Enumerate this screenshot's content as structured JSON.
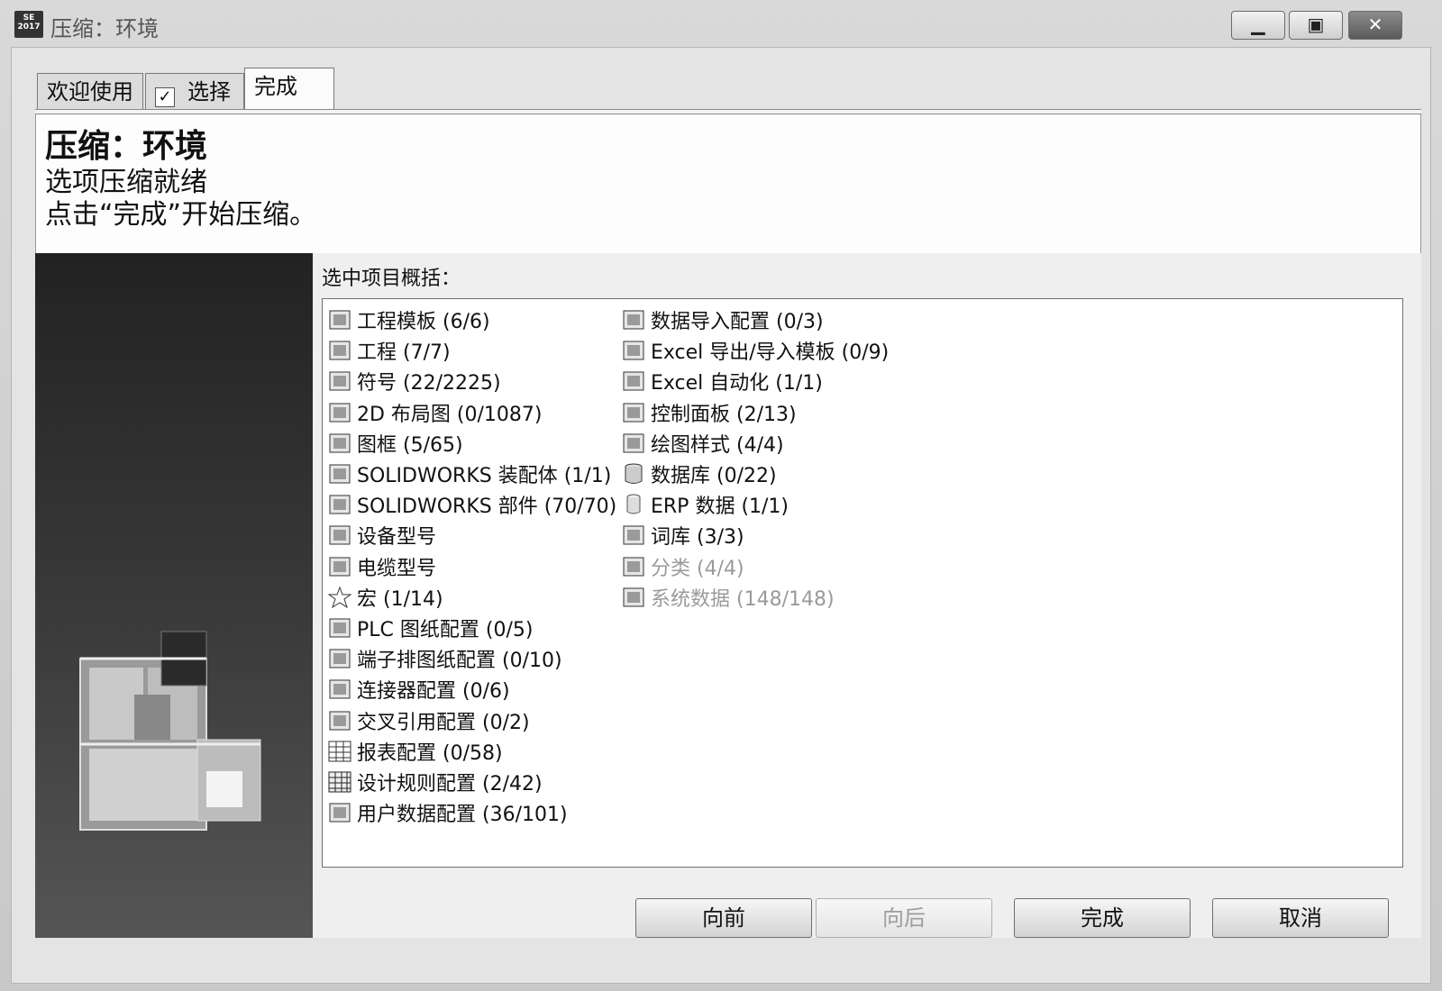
{
  "window": {
    "title": "压缩：环境",
    "app_icon_text": "SE 2017"
  },
  "tabs": [
    {
      "label": "欢迎使用"
    },
    {
      "label": "选择",
      "checked": true
    },
    {
      "label": "完成",
      "active": true
    }
  ],
  "header": {
    "title": "压缩：环境",
    "line1": "选项压缩就绪",
    "line2": "点击“完成”开始压缩。"
  },
  "summary": {
    "label": "选中项目概括：",
    "left_items": [
      {
        "icon": "template-icon",
        "label": "工程模板 (6/6)"
      },
      {
        "icon": "project-icon",
        "label": "工程 (7/7)"
      },
      {
        "icon": "symbol-icon",
        "label": "符号 (22/2225)"
      },
      {
        "icon": "layout-2d-icon",
        "label": "2D 布局图 (0/1087)"
      },
      {
        "icon": "title-block-icon",
        "label": "图框 (5/65)"
      },
      {
        "icon": "solidworks-assembly-icon",
        "label": "SOLIDWORKS 装配体 (1/1)"
      },
      {
        "icon": "solidworks-part-icon",
        "label": "SOLIDWORKS 部件 (70/70)"
      },
      {
        "icon": "equipment-type-icon",
        "label": "设备型号"
      },
      {
        "icon": "cable-type-icon",
        "label": "电缆型号"
      },
      {
        "icon": "macro-star-icon",
        "label": "宏 (1/14)"
      },
      {
        "icon": "plc-icon",
        "label": "PLC 图纸配置 (0/5)"
      },
      {
        "icon": "terminal-strip-icon",
        "label": "端子排图纸配置 (0/10)"
      },
      {
        "icon": "connector-icon",
        "label": "连接器配置 (0/6)"
      },
      {
        "icon": "cross-reference-icon",
        "label": "交叉引用配置 (0/2)"
      },
      {
        "icon": "report-table-icon",
        "label": "报表配置 (0/58)"
      },
      {
        "icon": "design-rule-icon",
        "label": "设计规则配置 (2/42)"
      },
      {
        "icon": "user-data-icon",
        "label": "用户数据配置 (36/101)"
      }
    ],
    "right_items": [
      {
        "icon": "data-import-icon",
        "label": "数据导入配置 (0/3)"
      },
      {
        "icon": "excel-xls-icon",
        "label": "Excel 导出/导入模板 (0/9)"
      },
      {
        "icon": "excel-automation-icon",
        "label": "Excel 自动化 (1/1)"
      },
      {
        "icon": "control-panel-icon",
        "label": "控制面板 (2/13)"
      },
      {
        "icon": "drawing-style-icon",
        "label": "绘图样式 (4/4)"
      },
      {
        "icon": "database-icon",
        "label": "数据库 (0/22)"
      },
      {
        "icon": "erp-data-icon",
        "label": "ERP 数据 (1/1)"
      },
      {
        "icon": "vocabulary-icon",
        "label": "词库 (3/3)"
      },
      {
        "icon": "classification-tree-icon",
        "label": "分类 (4/4)",
        "dim": true
      },
      {
        "icon": "system-data-icon",
        "label": "系统数据 (148/148)",
        "dim": true
      }
    ]
  },
  "buttons": {
    "back": "向前",
    "next": "向后",
    "finish": "完成",
    "cancel": "取消"
  }
}
